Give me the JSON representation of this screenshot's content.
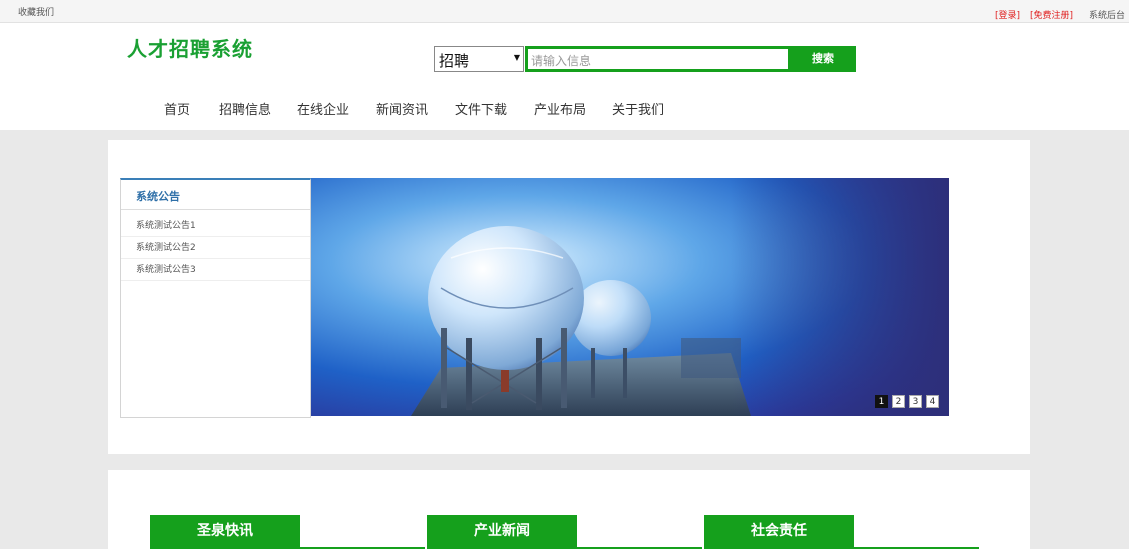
{
  "topbar": {
    "favorite": "收藏我们",
    "login": "[登录]",
    "register": "[免费注册]",
    "admin": "系统后台"
  },
  "header": {
    "logo": "人才招聘系统",
    "search": {
      "select_value": "招聘",
      "placeholder": "请输入信息",
      "button": "搜索"
    }
  },
  "nav": [
    "首页",
    "招聘信息",
    "在线企业",
    "新闻资讯",
    "文件下载",
    "产业布局",
    "关于我们"
  ],
  "notice": {
    "title": "系统公告",
    "items": [
      "系统测试公告1",
      "系统测试公告2",
      "系统测试公告3"
    ]
  },
  "banner": {
    "pages": [
      "1",
      "2",
      "3",
      "4"
    ],
    "active_page": "1"
  },
  "sections": [
    "圣泉快讯",
    "产业新闻",
    "社会责任"
  ],
  "colors": {
    "brand_green": "#15a01c",
    "link_red": "#e02020",
    "notice_blue": "#2e6fa8"
  }
}
